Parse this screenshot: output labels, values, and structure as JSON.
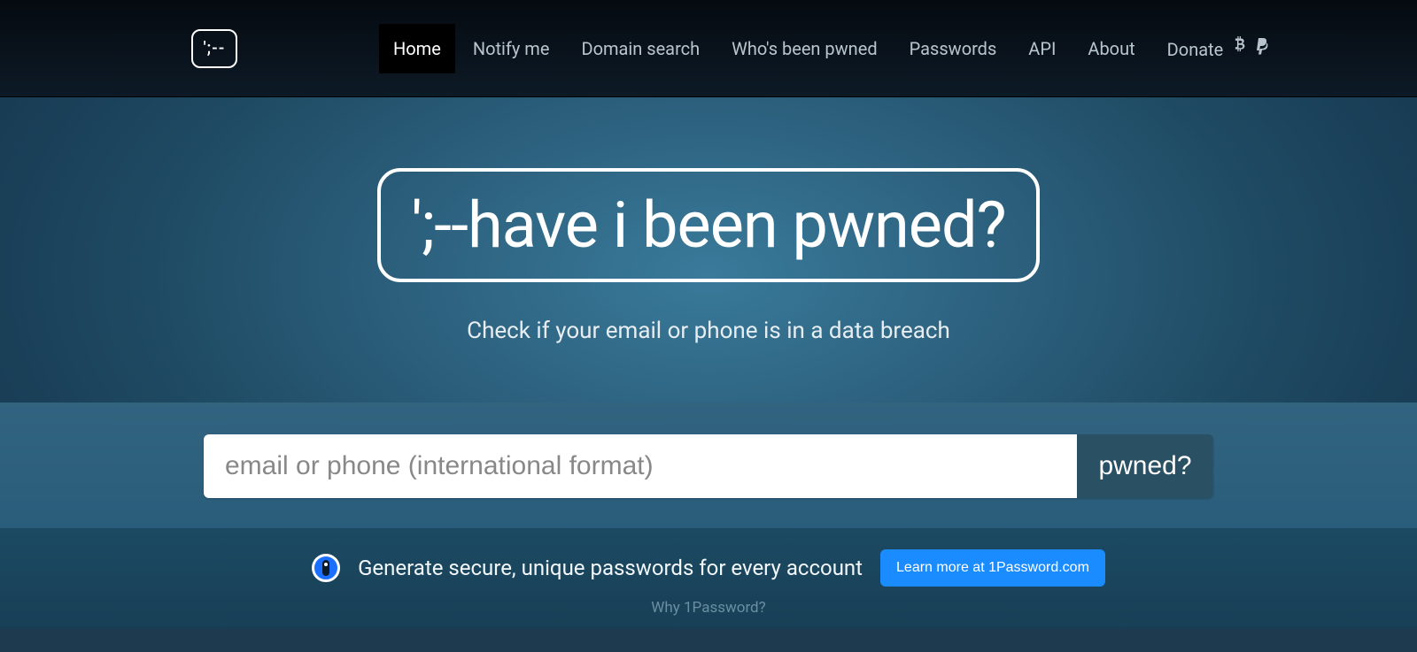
{
  "nav": {
    "logo": "';--",
    "items": [
      {
        "label": "Home",
        "active": true
      },
      {
        "label": "Notify me",
        "active": false
      },
      {
        "label": "Domain search",
        "active": false
      },
      {
        "label": "Who's been pwned",
        "active": false
      },
      {
        "label": "Passwords",
        "active": false
      },
      {
        "label": "API",
        "active": false
      },
      {
        "label": "About",
        "active": false
      }
    ],
    "donate_label": "Donate"
  },
  "hero": {
    "title": "';--have i been pwned?",
    "subtitle": "Check if your email or phone is in a data breach"
  },
  "search": {
    "placeholder": "email or phone (international format)",
    "button": "pwned?"
  },
  "promo": {
    "text": "Generate secure, unique passwords for every account",
    "button": "Learn more at 1Password.com",
    "why_link": "Why 1Password?"
  }
}
